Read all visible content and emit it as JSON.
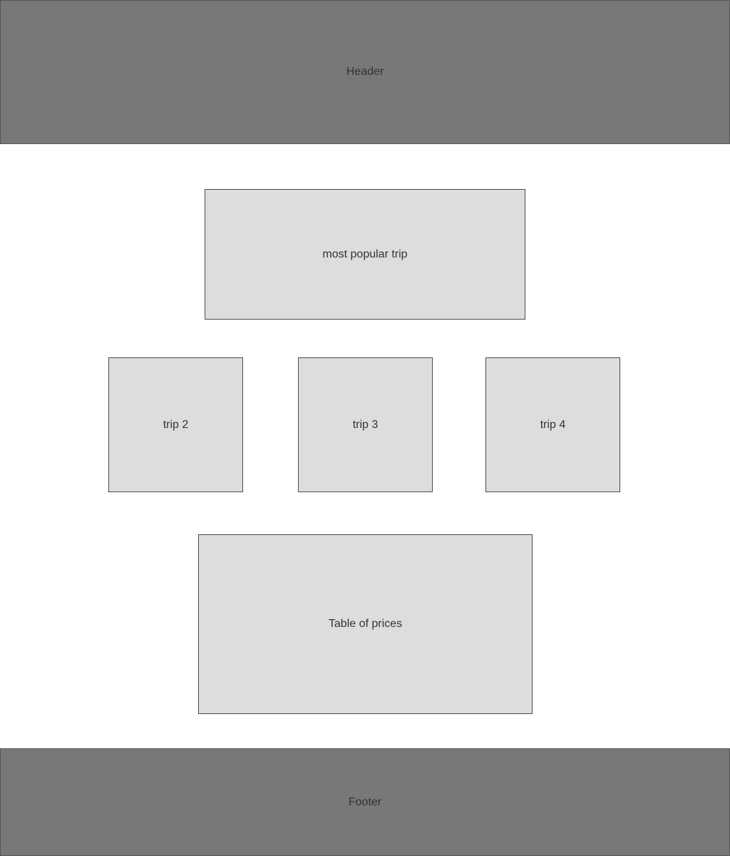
{
  "header": {
    "label": "Header"
  },
  "main": {
    "popular_trip": {
      "label": "most popular trip"
    },
    "trips": [
      {
        "label": "trip 2"
      },
      {
        "label": "trip 3"
      },
      {
        "label": "trip 4"
      }
    ],
    "prices_table": {
      "label": "Table of prices"
    }
  },
  "footer": {
    "label": "Footer"
  },
  "colors": {
    "header_footer_fill": "#787878",
    "content_box_fill": "#dddddd",
    "border": "#444444",
    "text": "#333333",
    "background": "#ffffff"
  }
}
